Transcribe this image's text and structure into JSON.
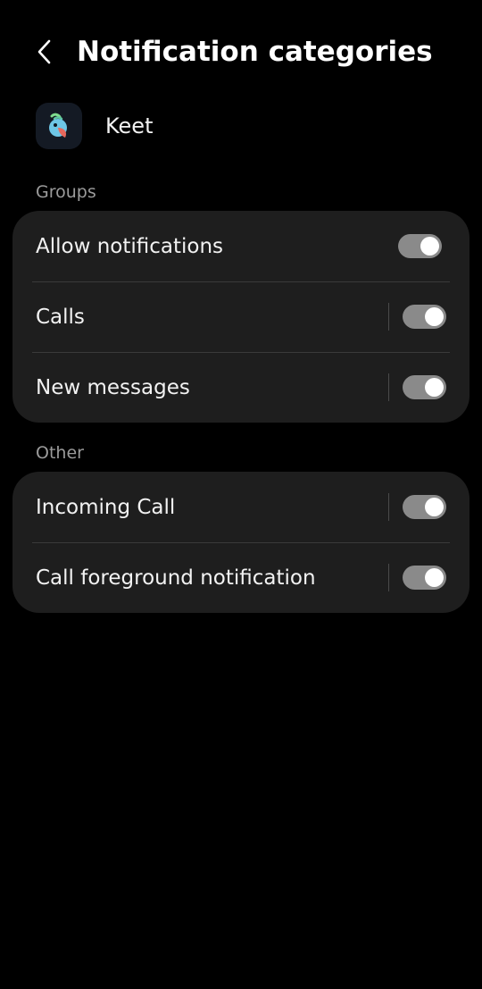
{
  "header": {
    "title": "Notification categories",
    "back_icon": "chevron-left-icon"
  },
  "app": {
    "name": "Keet",
    "icon": "keet-parrot-icon"
  },
  "sections": [
    {
      "label": "Groups",
      "items": [
        {
          "label": "Allow notifications",
          "toggle_on": true,
          "has_divider": false
        },
        {
          "label": "Calls",
          "toggle_on": true,
          "has_divider": true
        },
        {
          "label": "New messages",
          "toggle_on": true,
          "has_divider": true
        }
      ]
    },
    {
      "label": "Other",
      "items": [
        {
          "label": "Incoming Call",
          "toggle_on": true,
          "has_divider": true
        },
        {
          "label": "Call foreground notification",
          "toggle_on": true,
          "has_divider": true
        }
      ]
    }
  ],
  "colors": {
    "background": "#000000",
    "card": "#1e1e1e",
    "section_label": "#9b9b9b",
    "toggle_track": "#8a8a8a",
    "toggle_knob": "#ffffff"
  }
}
